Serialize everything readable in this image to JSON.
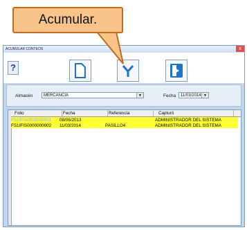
{
  "tooltip": {
    "text": "Acumular."
  },
  "window": {
    "title": "ACUMULAR CONTEOS",
    "close_label": "x"
  },
  "toolbar": {
    "help_label": "?",
    "buttons": [
      {
        "icon": "new-document-icon"
      },
      {
        "icon": "accumulate-funnel-icon"
      },
      {
        "icon": "exit-icon"
      }
    ]
  },
  "filters": {
    "almacen_label": "Almacén",
    "almacen_value": "MERCANCIA",
    "fecha_label": "Fecha",
    "fecha_value": "11/03/2014"
  },
  "grid": {
    "columns": [
      "Folio",
      "Fecha",
      "Referencia",
      "Capturó"
    ],
    "rows": [
      {
        "folio": "FS1IFIS0000000001",
        "fecha": "08/06/2013",
        "referencia": "",
        "capturo": "ADMINISTRADOR DEL SISTEMA"
      },
      {
        "folio": "FS1IFIS0000000002",
        "fecha": "11/03/2014",
        "referencia": "PASILLO4",
        "capturo": "ADMINISTRADOR DEL SISTEMA"
      }
    ]
  },
  "colors": {
    "highlight": "#ffff33",
    "tooltip_bg": "#f8c48a",
    "window_bg": "#bfd6ee"
  }
}
